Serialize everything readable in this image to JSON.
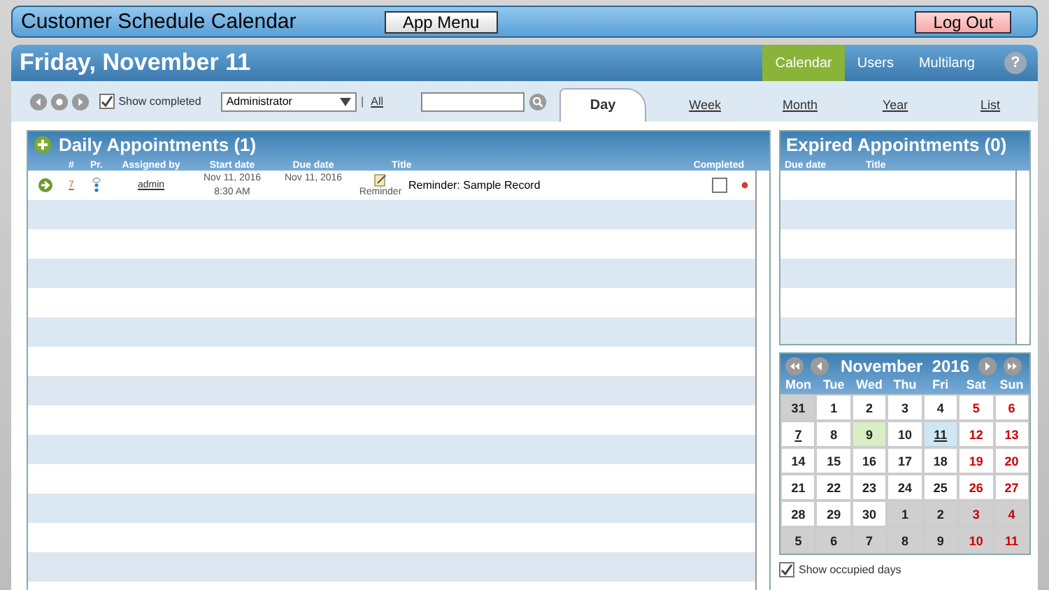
{
  "app_bar": {
    "title": "Customer Schedule Calendar",
    "menu_button": "App Menu",
    "logout_button": "Log Out"
  },
  "header": {
    "date": "Friday, November 11",
    "nav": [
      {
        "label": "Calendar",
        "selected": true
      },
      {
        "label": "Users",
        "selected": false
      },
      {
        "label": "Multilang",
        "selected": false
      }
    ],
    "help": "?"
  },
  "toolbar": {
    "show_completed": {
      "label": "Show completed",
      "checked": true
    },
    "user_select": "Administrator",
    "separator": "|",
    "all_link": "All"
  },
  "view_tabs": [
    {
      "label": "Day",
      "selected": true
    },
    {
      "label": "Week",
      "selected": false
    },
    {
      "label": "Month",
      "selected": false
    },
    {
      "label": "Year",
      "selected": false
    },
    {
      "label": "List",
      "selected": false
    }
  ],
  "daily": {
    "title": "Daily Appointments (1)",
    "columns": [
      "#",
      "Pr.",
      "Assigned by",
      "Start date",
      "Due date",
      "Title",
      "Completed"
    ],
    "rows": [
      {
        "number": "7",
        "assigned_by": "admin",
        "start_date": "Nov 11, 2016",
        "start_time": "8:30 AM",
        "due_date": "Nov 11, 2016",
        "type": "Reminder",
        "title": "Reminder: Sample Record",
        "completed": false
      }
    ]
  },
  "expired": {
    "title": "Expired Appointments (0)",
    "columns": [
      "Due date",
      "Title"
    ]
  },
  "calendar": {
    "month": "November",
    "year": "2016",
    "weekdays": [
      "Mon",
      "Tue",
      "Wed",
      "Thu",
      "Fri",
      "Sat",
      "Sun"
    ],
    "days": [
      {
        "day": "31",
        "outside": true,
        "occupied": false,
        "today": false,
        "selected": false
      },
      {
        "day": "1",
        "outside": false,
        "occupied": false,
        "today": false,
        "selected": false
      },
      {
        "day": "2",
        "outside": false,
        "occupied": false,
        "today": false,
        "selected": false
      },
      {
        "day": "3",
        "outside": false,
        "occupied": false,
        "today": false,
        "selected": false
      },
      {
        "day": "4",
        "outside": false,
        "occupied": false,
        "today": false,
        "selected": false
      },
      {
        "day": "5",
        "outside": false,
        "occupied": false,
        "today": false,
        "selected": false
      },
      {
        "day": "6",
        "outside": false,
        "occupied": false,
        "today": false,
        "selected": false
      },
      {
        "day": "7",
        "outside": false,
        "occupied": true,
        "today": false,
        "selected": false
      },
      {
        "day": "8",
        "outside": false,
        "occupied": false,
        "today": false,
        "selected": false
      },
      {
        "day": "9",
        "outside": false,
        "occupied": false,
        "today": true,
        "selected": false
      },
      {
        "day": "10",
        "outside": false,
        "occupied": false,
        "today": false,
        "selected": false
      },
      {
        "day": "11",
        "outside": false,
        "occupied": true,
        "today": false,
        "selected": true
      },
      {
        "day": "12",
        "outside": false,
        "occupied": false,
        "today": false,
        "selected": false
      },
      {
        "day": "13",
        "outside": false,
        "occupied": false,
        "today": false,
        "selected": false
      },
      {
        "day": "14",
        "outside": false,
        "occupied": false,
        "today": false,
        "selected": false
      },
      {
        "day": "15",
        "outside": false,
        "occupied": false,
        "today": false,
        "selected": false
      },
      {
        "day": "16",
        "outside": false,
        "occupied": false,
        "today": false,
        "selected": false
      },
      {
        "day": "17",
        "outside": false,
        "occupied": false,
        "today": false,
        "selected": false
      },
      {
        "day": "18",
        "outside": false,
        "occupied": false,
        "today": false,
        "selected": false
      },
      {
        "day": "19",
        "outside": false,
        "occupied": false,
        "today": false,
        "selected": false
      },
      {
        "day": "20",
        "outside": false,
        "occupied": false,
        "today": false,
        "selected": false
      },
      {
        "day": "21",
        "outside": false,
        "occupied": false,
        "today": false,
        "selected": false
      },
      {
        "day": "22",
        "outside": false,
        "occupied": false,
        "today": false,
        "selected": false
      },
      {
        "day": "23",
        "outside": false,
        "occupied": false,
        "today": false,
        "selected": false
      },
      {
        "day": "24",
        "outside": false,
        "occupied": false,
        "today": false,
        "selected": false
      },
      {
        "day": "25",
        "outside": false,
        "occupied": false,
        "today": false,
        "selected": false
      },
      {
        "day": "26",
        "outside": false,
        "occupied": false,
        "today": false,
        "selected": false
      },
      {
        "day": "27",
        "outside": false,
        "occupied": false,
        "today": false,
        "selected": false
      },
      {
        "day": "28",
        "outside": false,
        "occupied": false,
        "today": false,
        "selected": false
      },
      {
        "day": "29",
        "outside": false,
        "occupied": false,
        "today": false,
        "selected": false
      },
      {
        "day": "30",
        "outside": false,
        "occupied": false,
        "today": false,
        "selected": false
      },
      {
        "day": "1",
        "outside": true,
        "occupied": false,
        "today": false,
        "selected": false
      },
      {
        "day": "2",
        "outside": true,
        "occupied": false,
        "today": false,
        "selected": false
      },
      {
        "day": "3",
        "outside": true,
        "occupied": false,
        "today": false,
        "selected": false
      },
      {
        "day": "4",
        "outside": true,
        "occupied": false,
        "today": false,
        "selected": false
      },
      {
        "day": "5",
        "outside": true,
        "occupied": false,
        "today": false,
        "selected": false
      },
      {
        "day": "6",
        "outside": true,
        "occupied": false,
        "today": false,
        "selected": false
      },
      {
        "day": "7",
        "outside": true,
        "occupied": false,
        "today": false,
        "selected": false
      },
      {
        "day": "8",
        "outside": true,
        "occupied": false,
        "today": false,
        "selected": false
      },
      {
        "day": "9",
        "outside": true,
        "occupied": false,
        "today": false,
        "selected": false
      },
      {
        "day": "10",
        "outside": true,
        "occupied": false,
        "today": false,
        "selected": false
      },
      {
        "day": "11",
        "outside": true,
        "occupied": false,
        "today": false,
        "selected": false
      }
    ],
    "show_occupied": {
      "label": "Show occupied days",
      "checked": true
    }
  }
}
